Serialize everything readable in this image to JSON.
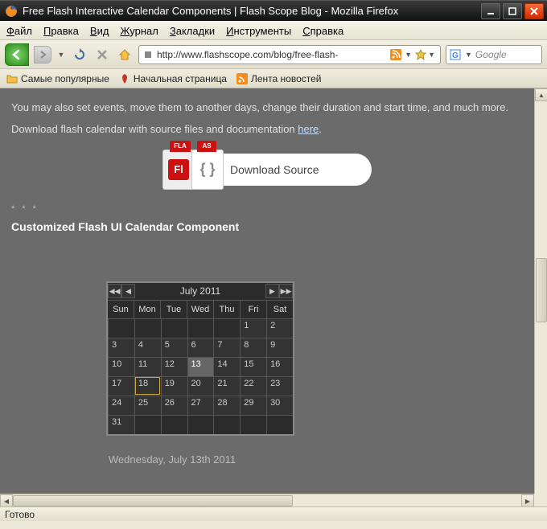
{
  "window": {
    "title": "Free Flash Interactive Calendar Components | Flash Scope Blog - Mozilla Firefox"
  },
  "menu": {
    "file": "Файл",
    "edit": "Правка",
    "view": "Вид",
    "history": "Журнал",
    "bookmarks": "Закладки",
    "tools": "Инструменты",
    "help": "Справка"
  },
  "nav": {
    "url": "http://www.flashscope.com/blog/free-flash-"
  },
  "search": {
    "placeholder": "Google"
  },
  "bookmarks": {
    "popular": "Самые популярные",
    "home": "Начальная страница",
    "news": "Лента новостей"
  },
  "page": {
    "line1": "You may also set events, move them to another days, change their duration and start time, and much more.",
    "line2_a": "Download flash calendar with source files and documentation ",
    "line2_link": "here",
    "line2_b": ".",
    "download_label": "Download Source",
    "stars": "* * *",
    "section_title": "Customized Flash UI Calendar Component",
    "selected_date": "Wednesday, July 13th 2011"
  },
  "calendar": {
    "title": "July  2011",
    "dow": [
      "Sun",
      "Mon",
      "Tue",
      "Wed",
      "Thu",
      "Fri",
      "Sat"
    ],
    "cells": [
      "",
      "",
      "",
      "",
      "",
      "1",
      "2",
      "3",
      "4",
      "5",
      "6",
      "7",
      "8",
      "9",
      "10",
      "11",
      "12",
      "13",
      "14",
      "15",
      "16",
      "17",
      "18",
      "19",
      "20",
      "21",
      "22",
      "23",
      "24",
      "25",
      "26",
      "27",
      "28",
      "29",
      "30",
      "31",
      "",
      "",
      "",
      "",
      "",
      ""
    ],
    "selected_index": 17,
    "today_index": 22
  },
  "status": {
    "text": "Готово"
  }
}
